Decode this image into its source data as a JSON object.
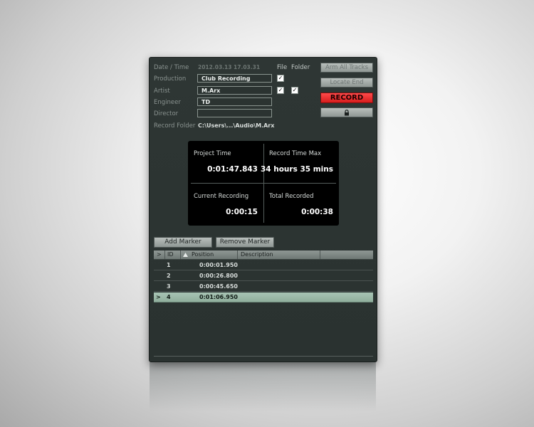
{
  "info": {
    "date_time_label": "Date / Time",
    "date_time_value": "2012.03.13 17.03.31",
    "production_label": "Production",
    "production_value": "Club Recording",
    "artist_label": "Artist",
    "artist_value": "M.Arx",
    "engineer_label": "Engineer",
    "engineer_value": "TD",
    "director_label": "Director",
    "director_value": "",
    "record_folder_label": "Record Folder",
    "record_folder_value": "C:\\Users\\...\\Audio\\M.Arx",
    "file_header": "File",
    "folder_header": "Folder",
    "checkbox_mark": "✓"
  },
  "buttons": {
    "arm_all_tracks": "Arm All Tracks",
    "locate_end": "Locate End",
    "record": "RECORD",
    "lock_icon": "lock-icon"
  },
  "stats": {
    "project_time_label": "Project Time",
    "project_time_value": "0:01:47.843",
    "record_time_max_label": "Record Time Max",
    "record_time_max_value": "34 hours 35 mins",
    "current_recording_label": "Current Recording",
    "current_recording_value": "0:00:15",
    "total_recorded_label": "Total Recorded",
    "total_recorded_value": "0:00:38"
  },
  "markers": {
    "add_label": "Add Marker",
    "remove_label": "Remove Marker",
    "columns": {
      "arrow": ">",
      "id": "ID",
      "position": "Position",
      "description": "Description"
    },
    "rows": [
      {
        "marker": "",
        "id": "1",
        "position": "0:00:01.950",
        "description": ""
      },
      {
        "marker": "",
        "id": "2",
        "position": "0:00:26.800",
        "description": ""
      },
      {
        "marker": "",
        "id": "3",
        "position": "0:00:45.650",
        "description": ""
      },
      {
        "marker": ">",
        "id": "4",
        "position": "0:01:06.950",
        "description": ""
      }
    ]
  },
  "colors": {
    "record": "#e52a2a",
    "selected_row": "#9dbaa9",
    "panel": "#2c3432"
  }
}
